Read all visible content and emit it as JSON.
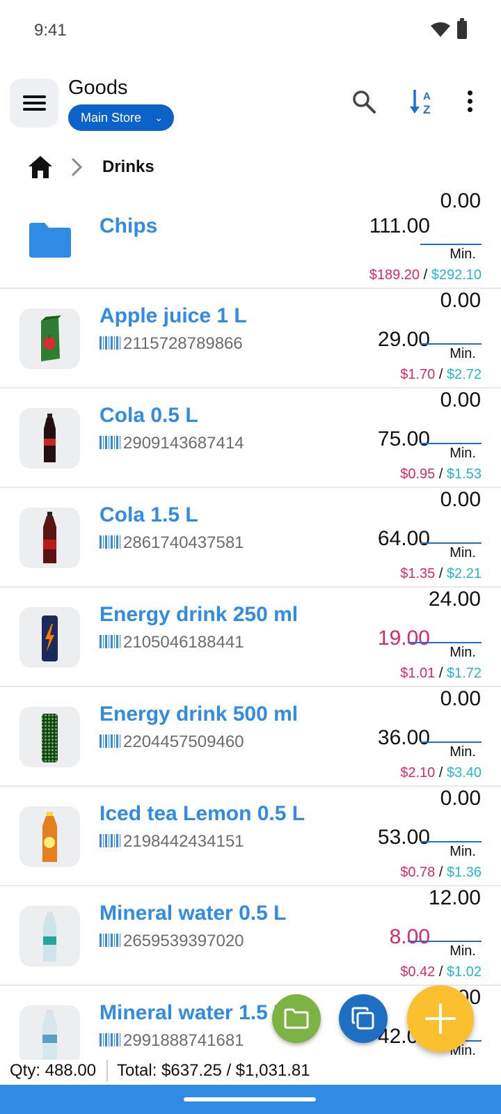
{
  "status_bar": {
    "time": "9:41"
  },
  "header": {
    "title": "Goods",
    "store": "Main Store"
  },
  "breadcrumb": {
    "current": "Drinks"
  },
  "list": {
    "folder": {
      "name": "Chips",
      "qty": "111.00",
      "min": "0.00",
      "min_label": "Min.",
      "cost": "$189.20",
      "sell": "$292.10"
    },
    "items": [
      {
        "name": "Apple juice 1 L",
        "barcode": "2115728789866",
        "qty": "29.00",
        "min": "0.00",
        "min_label": "Min.",
        "cost": "$1.70",
        "sell": "$2.72",
        "below_min": false,
        "thumb": "juice-carton"
      },
      {
        "name": "Cola 0.5 L",
        "barcode": "2909143687414",
        "qty": "75.00",
        "min": "0.00",
        "min_label": "Min.",
        "cost": "$0.95",
        "sell": "$1.53",
        "below_min": false,
        "thumb": "cola-bottle"
      },
      {
        "name": "Cola 1.5 L",
        "barcode": "2861740437581",
        "qty": "64.00",
        "min": "0.00",
        "min_label": "Min.",
        "cost": "$1.35",
        "sell": "$2.21",
        "below_min": false,
        "thumb": "cola-bottle-red"
      },
      {
        "name": "Energy drink 250 ml",
        "barcode": "2105046188441",
        "qty": "19.00",
        "min": "24.00",
        "min_label": "Min.",
        "cost": "$1.01",
        "sell": "$1.72",
        "below_min": true,
        "thumb": "energy-can-blue"
      },
      {
        "name": "Energy drink 500 ml",
        "barcode": "2204457509460",
        "qty": "36.00",
        "min": "0.00",
        "min_label": "Min.",
        "cost": "$2.10",
        "sell": "$3.40",
        "below_min": false,
        "thumb": "energy-can-green"
      },
      {
        "name": "Iced tea Lemon 0.5 L",
        "barcode": "2198442434151",
        "qty": "53.00",
        "min": "0.00",
        "min_label": "Min.",
        "cost": "$0.78",
        "sell": "$1.36",
        "below_min": false,
        "thumb": "iced-tea-bottle"
      },
      {
        "name": "Mineral water 0.5 L",
        "barcode": "2659539397020",
        "qty": "8.00",
        "min": "12.00",
        "min_label": "Min.",
        "cost": "$0.42",
        "sell": "$1.02",
        "below_min": true,
        "thumb": "water-bottle"
      },
      {
        "name": "Mineral water 1.5 L",
        "barcode": "2991888741681",
        "qty": "42.00",
        "min": "0.00",
        "min_label": "Min.",
        "cost": "",
        "sell": "",
        "below_min": false,
        "thumb": "water-bottle-large"
      }
    ]
  },
  "footer": {
    "qty": "Qty: 488.00",
    "total": "Total: $637.25 / $1,031.81"
  },
  "colors": {
    "accent": "#2f8be3",
    "chip": "#0b63c9",
    "cost": "#e0266b",
    "sell": "#22b8cf",
    "fab_folder": "#7cb342",
    "fab_copy": "#1e6fc4",
    "fab_add": "#fbc02d"
  },
  "icons": {
    "menu": "menu-icon",
    "search": "search-icon",
    "sort": "sort-az-icon",
    "more": "more-vert-icon",
    "home": "home-icon",
    "folder": "folder-icon",
    "copy": "copy-icon",
    "add": "add-icon"
  }
}
